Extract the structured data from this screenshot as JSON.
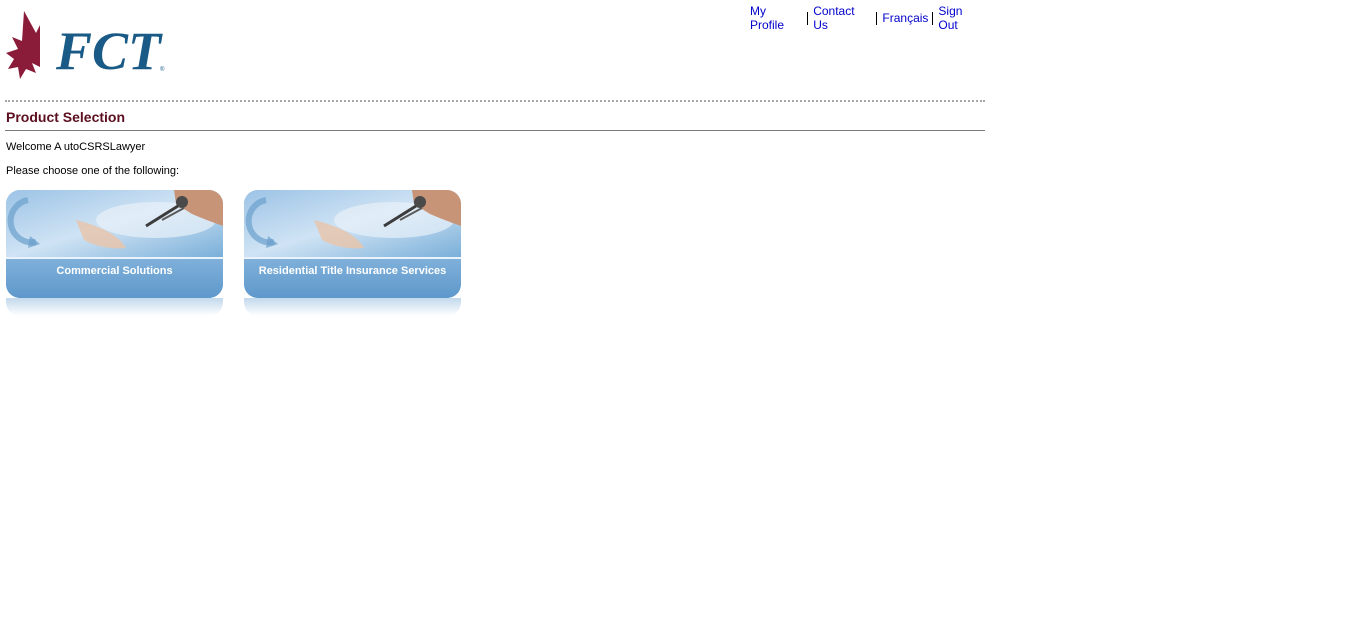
{
  "header": {
    "logo_text": "FCT",
    "links": [
      {
        "label": "My Profile"
      },
      {
        "label": "Contact Us"
      },
      {
        "label": "Français"
      },
      {
        "label": "Sign Out"
      }
    ]
  },
  "main": {
    "title": "Product Selection",
    "welcome": "Welcome A utoCSRSLawyer",
    "instruction": "Please choose one of the following:",
    "products": [
      {
        "label": "Commercial Solutions"
      },
      {
        "label": "Residential Title Insurance Services"
      }
    ]
  },
  "colors": {
    "link": "#0000cc",
    "title": "#5c0f1f",
    "logo_leaf": "#8a1c3a",
    "logo_text": "#1a5a86",
    "tile_band": "#6aa3d3"
  }
}
